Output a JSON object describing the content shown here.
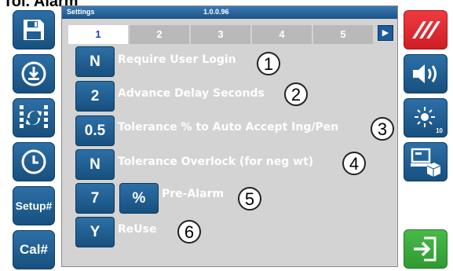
{
  "header": {
    "cut_title": "Tol. Alarm"
  },
  "window": {
    "title": "Settings",
    "version": "1.0.0.96"
  },
  "tabs": [
    "1",
    "2",
    "3",
    "4",
    "5"
  ],
  "left_buttons": {
    "setup_label": "Setup#",
    "cal_label": "Cal#"
  },
  "settings": [
    {
      "value": "N",
      "label": "Require User Login",
      "marker": "1"
    },
    {
      "value": "2",
      "label": "Advance Delay Seconds",
      "marker": "2"
    },
    {
      "value": "0.5",
      "label": "Tolerance % to Auto Accept Ing/Pen",
      "marker": "3"
    },
    {
      "value": "N",
      "label": "Tolerance Overlock (for neg wt)",
      "marker": "4"
    },
    {
      "value": "7",
      "unit": "%",
      "label": "Pre-Alarm",
      "marker": "5"
    },
    {
      "value": "Y",
      "label": "ReUse",
      "marker": "6"
    }
  ],
  "right_buttons": {
    "brightness_level": "10"
  },
  "colors": {
    "accent_blue": "#1f5f96",
    "alarm_red": "#e0282f",
    "enter_green": "#3aa83a",
    "panel_gray": "#d3d3d3"
  }
}
